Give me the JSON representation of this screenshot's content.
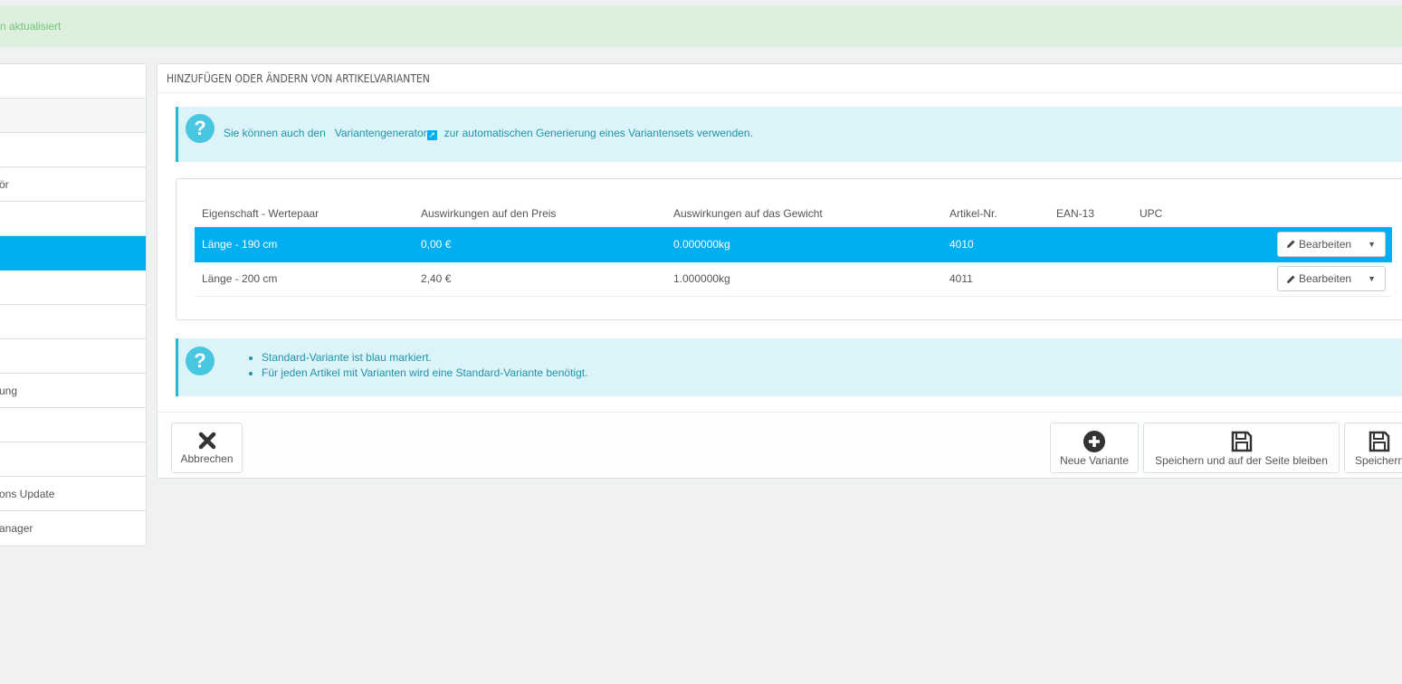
{
  "alert": {
    "text": "n aktualisiert"
  },
  "sidebar": {
    "items": [
      {
        "label": "",
        "style": ""
      },
      {
        "label": "",
        "style": "gray"
      },
      {
        "label": "",
        "style": ""
      },
      {
        "label": "ör",
        "style": ""
      },
      {
        "label": "",
        "style": ""
      },
      {
        "label": "",
        "style": "active"
      },
      {
        "label": "",
        "style": ""
      },
      {
        "label": "",
        "style": ""
      },
      {
        "label": "",
        "style": ""
      },
      {
        "label": "ung",
        "style": ""
      },
      {
        "label": "",
        "style": ""
      },
      {
        "label": "",
        "style": ""
      },
      {
        "label": "ons Update",
        "style": ""
      },
      {
        "label": "anager",
        "style": ""
      }
    ]
  },
  "panel": {
    "title": "HINZUFÜGEN ODER ÄNDERN VON ARTIKELVARIANTEN",
    "info1": {
      "prefix": "Sie können auch den",
      "link": "Variantengenerator",
      "suffix": "zur automatischen Generierung eines Variantensets verwenden."
    },
    "table": {
      "headers": [
        "Eigenschaft - Wertepaar",
        "Auswirkungen auf den Preis",
        "Auswirkungen auf das Gewicht",
        "Artikel-Nr.",
        "EAN-13",
        "UPC",
        ""
      ],
      "rows": [
        {
          "attribute": "Länge - 190 cm",
          "price": "0,00 €",
          "weight": "0.000000kg",
          "ref": "4010",
          "ean": "",
          "upc": "",
          "default": true
        },
        {
          "attribute": "Länge - 200 cm",
          "price": "2,40 €",
          "weight": "1.000000kg",
          "ref": "4011",
          "ean": "",
          "upc": "",
          "default": false
        }
      ],
      "edit_label": "Bearbeiten"
    },
    "info2": {
      "items": [
        "Standard-Variante ist blau markiert.",
        "Für jeden Artikel mit Varianten wird eine Standard-Variante benötigt."
      ]
    },
    "footer": {
      "cancel": "Abbrechen",
      "new_variant": "Neue Variante",
      "save_stay": "Speichern und auf der Seite bleiben",
      "save": "Speichern"
    }
  },
  "colors": {
    "accent": "#00aff0",
    "info_bg": "#dcf4f9",
    "info_text": "#1e94ab",
    "success_bg": "#ddf0de",
    "success_text": "#72c279"
  }
}
